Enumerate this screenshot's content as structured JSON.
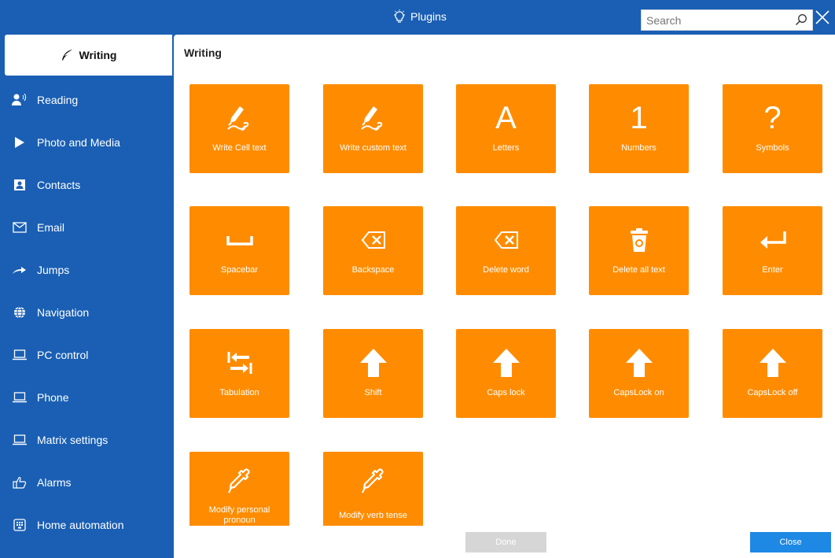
{
  "window": {
    "title": "Plugins",
    "close_icon": "close-icon",
    "title_icon": "lightbulb-icon"
  },
  "search": {
    "placeholder": "Search",
    "value": ""
  },
  "sidebar": {
    "items": [
      {
        "label": "Writing",
        "icon": "feather-icon",
        "active": true
      },
      {
        "label": "Reading",
        "icon": "person-speaking-icon"
      },
      {
        "label": "Photo and Media",
        "icon": "play-icon"
      },
      {
        "label": "Contacts",
        "icon": "contact-card-icon"
      },
      {
        "label": "Email",
        "icon": "envelope-icon"
      },
      {
        "label": "Jumps",
        "icon": "arrow-right-icon"
      },
      {
        "label": "Navigation",
        "icon": "globe-icon"
      },
      {
        "label": "PC control",
        "icon": "laptop-icon"
      },
      {
        "label": "Phone",
        "icon": "laptop-icon"
      },
      {
        "label": "Matrix settings",
        "icon": "laptop-icon"
      },
      {
        "label": "Alarms",
        "icon": "thumbs-up-icon"
      },
      {
        "label": "Home automation",
        "icon": "keypad-icon"
      }
    ]
  },
  "main": {
    "title": "Writing",
    "tiles": [
      {
        "label": "Write Cell text",
        "icon": "pen-write-icon"
      },
      {
        "label": "Write custom text",
        "icon": "pen-write-icon"
      },
      {
        "label": "Letters",
        "icon": "letter-a-icon",
        "glyph": "A"
      },
      {
        "label": "Numbers",
        "icon": "digit-one-icon",
        "glyph": "1"
      },
      {
        "label": "Symbols",
        "icon": "question-mark-icon",
        "glyph": "?"
      },
      {
        "label": "Spacebar",
        "icon": "spacebar-icon"
      },
      {
        "label": "Backspace",
        "icon": "backspace-icon"
      },
      {
        "label": "Delete word",
        "icon": "backspace-icon"
      },
      {
        "label": "Delete all text",
        "icon": "trash-icon"
      },
      {
        "label": "Enter",
        "icon": "enter-icon"
      },
      {
        "label": "Tabulation",
        "icon": "tab-icon"
      },
      {
        "label": "Shift",
        "icon": "arrow-up-icon"
      },
      {
        "label": "Caps lock",
        "icon": "arrow-up-icon"
      },
      {
        "label": "CapsLock on",
        "icon": "arrow-up-icon"
      },
      {
        "label": "CapsLock off",
        "icon": "arrow-up-icon"
      },
      {
        "label": "Modify personal pronoun",
        "icon": "pipette-icon"
      },
      {
        "label": "Modify verb tense",
        "icon": "pipette-icon"
      }
    ]
  },
  "footer": {
    "done_label": "Done",
    "close_label": "Close"
  },
  "colors": {
    "accent": "#1a5fb4",
    "tile": "#ff8c00",
    "close_button": "#1e88e5",
    "done_disabled": "#d6d6d6"
  }
}
